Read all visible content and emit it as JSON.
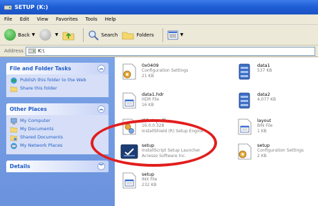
{
  "window": {
    "title": "SETUP (K:)",
    "accent": "#1f5fd6"
  },
  "menu": [
    "File",
    "Edit",
    "View",
    "Favorites",
    "Tools",
    "Help"
  ],
  "toolbar": {
    "back": "Back",
    "search": "Search",
    "folders": "Folders"
  },
  "address": {
    "label": "Address",
    "value": "K:\\"
  },
  "tasks_panel": {
    "title": "File and Folder Tasks",
    "items": [
      "Publish this folder to the Web",
      "Share this folder"
    ]
  },
  "places_panel": {
    "title": "Other Places",
    "items": [
      "My Computer",
      "My Documents",
      "Shared Documents",
      "My Network Places"
    ]
  },
  "details_panel": {
    "title": "Details"
  },
  "files": [
    {
      "name": "0x0409",
      "line1": "Configuration Settings",
      "line2": "21 KB",
      "icon": "config-icon"
    },
    {
      "name": "data1",
      "line1": "537 KB",
      "line2": "",
      "icon": "cab-icon"
    },
    {
      "name": "data1.hdr",
      "line1": "HDR File",
      "line2": "16 KB",
      "icon": "generic-file-icon"
    },
    {
      "name": "data2",
      "line1": "4,077 KB",
      "line2": "",
      "icon": "cab-icon"
    },
    {
      "name": "ISSetup.dll",
      "line1": "16.0.0.328",
      "line2": "InstallShield (R) Setup Engine",
      "icon": "dll-icon"
    },
    {
      "name": "layout",
      "line1": "BIN File",
      "line2": "1 KB",
      "icon": "generic-file-icon"
    },
    {
      "name": "setup",
      "line1": "InstallScript Setup Launcher",
      "line2": "Acresso Software Inc.",
      "icon": "setup-launcher-icon"
    },
    {
      "name": "setup",
      "line1": "Configuration Settings",
      "line2": "2 KB",
      "icon": "config-icon"
    },
    {
      "name": "setup",
      "line1": "INX File",
      "line2": "232 KB",
      "icon": "generic-file-icon"
    }
  ],
  "highlight_color": "#e21d1d"
}
